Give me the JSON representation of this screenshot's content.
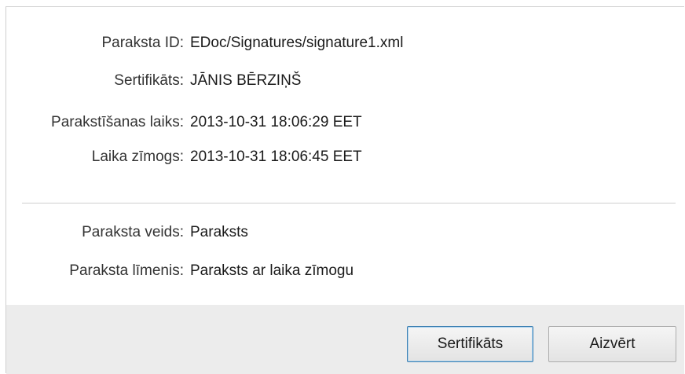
{
  "details": {
    "signature_id": {
      "label": "Paraksta ID:",
      "value": "EDoc/Signatures/signature1.xml"
    },
    "certificate": {
      "label": "Sertifikāts:",
      "value": "JĀNIS BĒRZIŅŠ"
    },
    "signing_time": {
      "label": "Parakstīšanas laiks:",
      "value": "2013-10-31 18:06:29 EET"
    },
    "timestamp": {
      "label": "Laika zīmogs:",
      "value": "2013-10-31 18:06:45 EET"
    },
    "signature_type": {
      "label": "Paraksta veids:",
      "value": "Paraksts"
    },
    "signature_level": {
      "label": "Paraksta līmenis:",
      "value": "Paraksts ar laika zīmogu"
    }
  },
  "buttons": {
    "certificate_label": "Sertifikāts",
    "close_label": "Aizvērt"
  }
}
